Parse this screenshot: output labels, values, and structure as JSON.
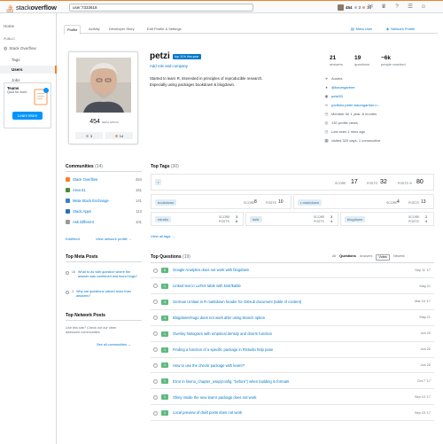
{
  "topbar": {
    "logo_text_plain": "stack",
    "logo_text_bold": "overflow",
    "search_value": "user:7333618",
    "user_rep": "454",
    "badge_silver": "3",
    "badge_bronze": "16",
    "accent_color": "#f48024"
  },
  "leftnav": {
    "home": "Home",
    "public": "PUBLIC",
    "stack_overflow": "Stack Overflow",
    "tags": "Tags",
    "users": "Users",
    "jobs": "Jobs",
    "teams_title": "Teams",
    "teams_sub": "Q&A for work",
    "learn_more": "Learn More"
  },
  "tabs": {
    "profile": "Profile",
    "activity": "Activity",
    "developer_story": "Developer Story",
    "edit": "Edit Profile & Settings",
    "meta_user": "Meta User",
    "network_profile": "Network Profile"
  },
  "profile": {
    "reputation": "454",
    "reputation_label": "REPUTATION",
    "silver": "3",
    "bronze": "14",
    "name": "petzi",
    "top_badge": "top 11% this year",
    "add_role": "Add role and company",
    "bio_line1": "Started to learn R, interested in principles of reproducible research.",
    "bio_line2": "Especially using packages bookdown & blogdown.",
    "stats": [
      {
        "num": "21",
        "label": "answers"
      },
      {
        "num": "19",
        "label": "questions"
      },
      {
        "num": "~6k",
        "label": "people reached"
      }
    ],
    "meta": [
      {
        "icon": "location-icon",
        "glyph": "⌖",
        "text": "Austria"
      },
      {
        "icon": "twitter-icon",
        "glyph": "♦",
        "text": "@baumgartner"
      },
      {
        "icon": "github-icon",
        "glyph": "◉",
        "text": "petzi53"
      },
      {
        "icon": "link-icon",
        "glyph": "∞",
        "text": "portfolio.peter-baumgartner.n..."
      },
      {
        "icon": "clock-icon",
        "glyph": "◷",
        "text": "Member for 1 year, 8 months"
      },
      {
        "icon": "eye-icon",
        "glyph": "◎",
        "text": "130 profile views"
      },
      {
        "icon": "clock-icon",
        "glyph": "◷",
        "text": "Last seen 1 mins ago"
      },
      {
        "icon": "calendar-icon",
        "glyph": "▦",
        "text": "visited 320 days, 1 consecutive"
      }
    ]
  },
  "communities": {
    "title": "Communities",
    "count": "(14)",
    "items": [
      {
        "name": "Stack Overflow",
        "rep": "454",
        "color": "#f48024"
      },
      {
        "name": "Area 51",
        "rep": "151",
        "color": "#4a8b3a"
      },
      {
        "name": "Meta Stack Exchange",
        "rep": "141",
        "color": "#3b7fc4"
      },
      {
        "name": "Stack Apps",
        "rep": "113",
        "color": "#2f6fb0"
      },
      {
        "name": "Ask Different",
        "rep": "101",
        "color": "#999999"
      }
    ],
    "edit": "Edit/feed",
    "view_network": "View network profile →"
  },
  "top_meta_posts": {
    "title": "Top Meta Posts",
    "items": [
      {
        "score": "18",
        "text": "What to do with question where the answer was confirmed and found bugs?"
      },
      {
        "score": "3",
        "text": "Why are questions valued more than answers?"
      }
    ]
  },
  "top_network_posts": {
    "title": "Top Network Posts",
    "text": "Like this site? Check out our other awesome communities",
    "see_all": "See all communities →"
  },
  "top_tags": {
    "title": "Top Tags",
    "count": "(30)",
    "main": {
      "name": "r",
      "score_label": "SCORE",
      "score": "17",
      "posts_label": "POSTS",
      "posts": "32",
      "posts_pct_label": "POSTS %",
      "posts_pct": "80"
    },
    "row2": [
      {
        "name": "bookdown",
        "score_label": "SCORE",
        "score": "8",
        "posts_label": "POSTS",
        "posts": "10"
      },
      {
        "name": "r-markdown",
        "score_label": "SCORE",
        "score": "4",
        "posts_label": "POSTS",
        "posts": "13"
      }
    ],
    "row3": [
      {
        "name": "rstudio",
        "score_label": "SCORE",
        "score": "3",
        "posts_label": "POSTS",
        "posts": "6"
      },
      {
        "name": "knitr",
        "score_label": "SCORE",
        "score": "3",
        "posts_label": "POSTS",
        "posts": "4"
      },
      {
        "name": "blogdown",
        "score_label": "SCORE",
        "score": "2",
        "posts_label": "POSTS",
        "posts": "4"
      }
    ],
    "view_all": "View all tags →"
  },
  "top_questions": {
    "title": "Top Questions",
    "count": "(19)",
    "filters": [
      "All",
      "Questions",
      "Answers"
    ],
    "sort": [
      "Votes",
      "Newest"
    ],
    "items": [
      {
        "score": "6",
        "title": "Google Analytics does not work with blogdown",
        "date": "Sep 11 '17"
      },
      {
        "score": "1",
        "title": "Linked text in LaTeX table with knitr/kable",
        "date": "May 21"
      },
      {
        "score": "4",
        "title": "German Umlaut in R markdown header for GitHub document (table of content)",
        "date": "Mar 10 '17"
      },
      {
        "score": "3",
        "title": "Blogdown/Hugo does not work after using branch option",
        "date": "May 21"
      },
      {
        "score": "1",
        "title": "Overlay histogram with empirical density and dnorm function",
        "date": "Jun 20"
      },
      {
        "score": "1",
        "title": "Finding a function of a specific package in RStudio help pane",
        "date": "Jun 20"
      },
      {
        "score": "1",
        "title": "How to use the checkr package with learnr?",
        "date": "Jun 20"
      },
      {
        "score": "1",
        "title": "Error in lineno_chapter_wrap(config, \"before\") when building in formats",
        "date": "Oct 7 '17"
      },
      {
        "score": "1",
        "title": "Shiny inside the new learnr package does not work",
        "date": "Sep 10 '17"
      },
      {
        "score": "1",
        "title": "Local preview of draft posts does not work",
        "date": "Sep 15 '17"
      }
    ]
  }
}
